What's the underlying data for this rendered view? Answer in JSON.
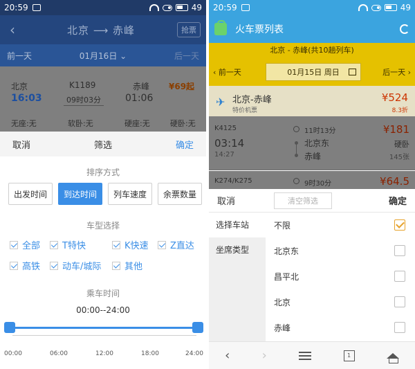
{
  "left": {
    "status": {
      "time": "20:59",
      "battery": "49"
    },
    "header": {
      "from": "北京",
      "to": "赤峰",
      "arrow": "⟶",
      "grab_ticket": "抢票"
    },
    "datebar": {
      "prev": "前一天",
      "date": "01月16日",
      "next": "后一天"
    },
    "train": {
      "from": "北京",
      "to": "赤峰",
      "code": "K1189",
      "duration": "09时03分",
      "depart": "16:03",
      "arrive": "01:06",
      "price": "¥69起",
      "seats": [
        "无座:无",
        "软卧:无",
        "硬座:无",
        "硬卧:无"
      ]
    },
    "filter": {
      "cancel": "取消",
      "title": "筛选",
      "confirm": "确定",
      "sort_title": "排序方式",
      "sort_options": [
        "出发时间",
        "到达时间",
        "列车速度",
        "余票数量"
      ],
      "type_title": "车型选择",
      "types": [
        "全部",
        "T特快",
        "K快速",
        "Z直达",
        "高铁",
        "动车/城际",
        "其他"
      ],
      "time_title": "乘车时间",
      "time_range": "00:00--24:00",
      "range": [
        0,
        24
      ],
      "ticks": [
        "00:00",
        "06:00",
        "12:00",
        "18:00",
        "24:00"
      ]
    }
  },
  "right": {
    "status": {
      "time": "20:59",
      "battery": "49"
    },
    "header": {
      "title": "火车票列表"
    },
    "summary": "北京 - 赤峰(共10趟列车)",
    "datebar": {
      "prev": "前一天",
      "date": "01月15日 周日",
      "next": "后一天"
    },
    "plane": {
      "route": "北京-赤峰",
      "sub": "特价机票",
      "price": "¥524",
      "discount": "8.3折"
    },
    "trains": [
      {
        "code": "K4125",
        "duration": "11时13分",
        "depart": "03:14",
        "arrive": "14:27",
        "from": "北京东",
        "to": "赤峰",
        "price": "¥181",
        "seat": "硬卧",
        "left": "145张"
      },
      {
        "code": "K274/K275",
        "duration": "9时30分",
        "price": "¥64.5"
      }
    ],
    "panel": {
      "cancel": "取消",
      "clear": "清空筛选",
      "confirm": "确定",
      "side": [
        "选择车站",
        "坐席类型"
      ],
      "options": [
        {
          "label": "不限",
          "checked": true
        },
        {
          "label": "北京东",
          "checked": false
        },
        {
          "label": "昌平北",
          "checked": false
        },
        {
          "label": "北京",
          "checked": false
        },
        {
          "label": "赤峰",
          "checked": false
        }
      ]
    },
    "nav": {
      "back": "‹",
      "forward": "›",
      "tabs": "1"
    }
  },
  "colors": {
    "accent_blue": "#3a8ee6",
    "toolbar_blue": "#3ba4df",
    "yellow_bar": "#e5c100",
    "check_orange": "#e6a22b",
    "price_red": "#cc3300"
  }
}
